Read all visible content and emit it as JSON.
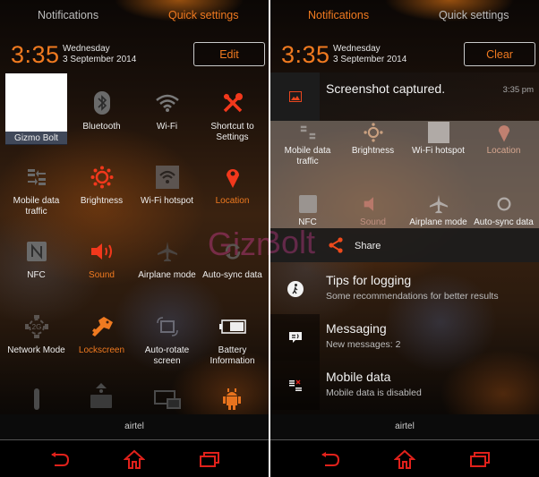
{
  "left_panel": {
    "tabs": [
      {
        "label": "Notifications",
        "active": false
      },
      {
        "label": "Quick settings",
        "active": true
      }
    ],
    "clock": "3:35",
    "day": "Wednesday",
    "date": "3 September 2014",
    "header_button": "Edit",
    "user_tile": {
      "name": "Gizmo Bolt"
    },
    "tiles": [
      {
        "label": "Bluetooth",
        "icon": "bluetooth-icon",
        "active": false
      },
      {
        "label": "Wi-Fi",
        "icon": "wifi-icon",
        "active": false
      },
      {
        "label": "Shortcut to Settings",
        "icon": "tools-icon",
        "active": false
      },
      {
        "label": "Mobile data traffic",
        "icon": "mobile-data-icon",
        "active": false
      },
      {
        "label": "Brightness",
        "icon": "brightness-icon",
        "active": false
      },
      {
        "label": "Wi-Fi hotspot",
        "icon": "hotspot-icon",
        "active": false
      },
      {
        "label": "Location",
        "icon": "location-pin-icon",
        "active": true
      },
      {
        "label": "NFC",
        "icon": "nfc-icon",
        "active": false
      },
      {
        "label": "Sound",
        "icon": "sound-icon",
        "active": true
      },
      {
        "label": "Airplane mode",
        "icon": "airplane-icon",
        "active": false
      },
      {
        "label": "Auto-sync data",
        "icon": "sync-icon",
        "active": false
      },
      {
        "label": "Network Mode",
        "icon": "network-2g-icon",
        "active": false
      },
      {
        "label": "Lockscreen",
        "icon": "key-icon",
        "active": true
      },
      {
        "label": "Auto-rotate screen",
        "icon": "rotate-icon",
        "active": false
      },
      {
        "label": "Battery Information",
        "icon": "battery-icon",
        "active": false
      }
    ],
    "partial_row_icons": [
      "flashlight-icon",
      "upload-icon",
      "screen-mirror-icon",
      "android-icon"
    ],
    "carrier": "airtel",
    "watermark": "Gizmo"
  },
  "right_panel": {
    "tabs": [
      {
        "label": "Notifications",
        "active": true
      },
      {
        "label": "Quick settings",
        "active": false
      }
    ],
    "clock": "3:35",
    "day": "Wednesday",
    "date": "3 September 2014",
    "header_button": "Clear",
    "notifications": [
      {
        "title": "Screenshot captured.",
        "subtitle": "",
        "time": "3:35 pm",
        "icon": "image-icon"
      },
      {
        "title": "Tips for logging",
        "subtitle": "Some recommendations for better results",
        "time": "",
        "icon": "walker-icon"
      },
      {
        "title": "Messaging",
        "subtitle": "New messages: 2",
        "time": "",
        "icon": "message-icon"
      },
      {
        "title": "Mobile data",
        "subtitle": "Mobile data is disabled",
        "time": "",
        "icon": "mobile-data-off-icon"
      }
    ],
    "background_tiles": [
      {
        "label": "Mobile data traffic"
      },
      {
        "label": "Brightness"
      },
      {
        "label": "Wi-Fi hotspot"
      },
      {
        "label": "Location"
      },
      {
        "label": "NFC"
      },
      {
        "label": "Sound"
      },
      {
        "label": "Airplane mode"
      },
      {
        "label": "Auto-sync data"
      }
    ],
    "share_label": "Share",
    "carrier": "airtel",
    "watermark": "Bolt"
  },
  "colors": {
    "accent": "#f07a20",
    "nav_red": "#e0211b",
    "icon_red": "#f2381c"
  }
}
